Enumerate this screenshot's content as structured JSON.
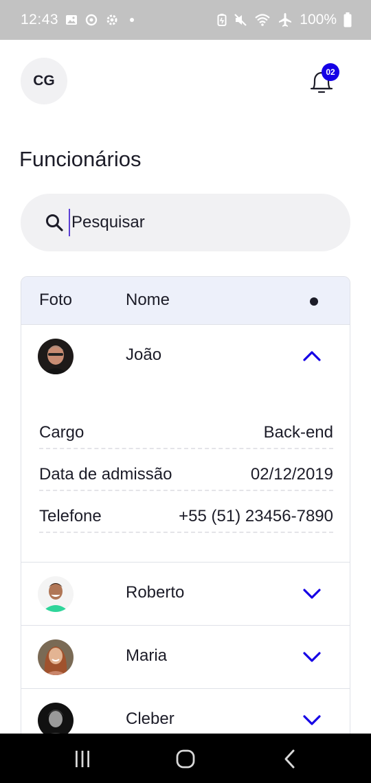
{
  "status_bar": {
    "time": "12:43",
    "battery": "100%",
    "left_icons": [
      "image-icon",
      "sync-icon",
      "settings-icon",
      "dot-icon"
    ],
    "right_icons": [
      "battery-saver-icon",
      "mute-icon",
      "wifi-icon",
      "airplane-icon",
      "battery-icon"
    ]
  },
  "header": {
    "avatar_initials": "CG",
    "notification_count": "02"
  },
  "page": {
    "title": "Funcionários"
  },
  "search": {
    "placeholder": "Pesquisar",
    "value": ""
  },
  "table": {
    "columns": [
      "Foto",
      "Nome"
    ],
    "rows": [
      {
        "name": "João",
        "expanded": true,
        "details": [
          {
            "label": "Cargo",
            "value": "Back-end"
          },
          {
            "label": "Data de admissão",
            "value": "02/12/2019"
          },
          {
            "label": "Telefone",
            "value": "+55 (51) 23456-7890"
          }
        ]
      },
      {
        "name": "Roberto",
        "expanded": false
      },
      {
        "name": "Maria",
        "expanded": false
      },
      {
        "name": "Cleber",
        "expanded": false
      }
    ]
  },
  "colors": {
    "accent": "#1500e6",
    "header_bg": "#edf0fa",
    "status_bar": "#c2c2c2"
  }
}
